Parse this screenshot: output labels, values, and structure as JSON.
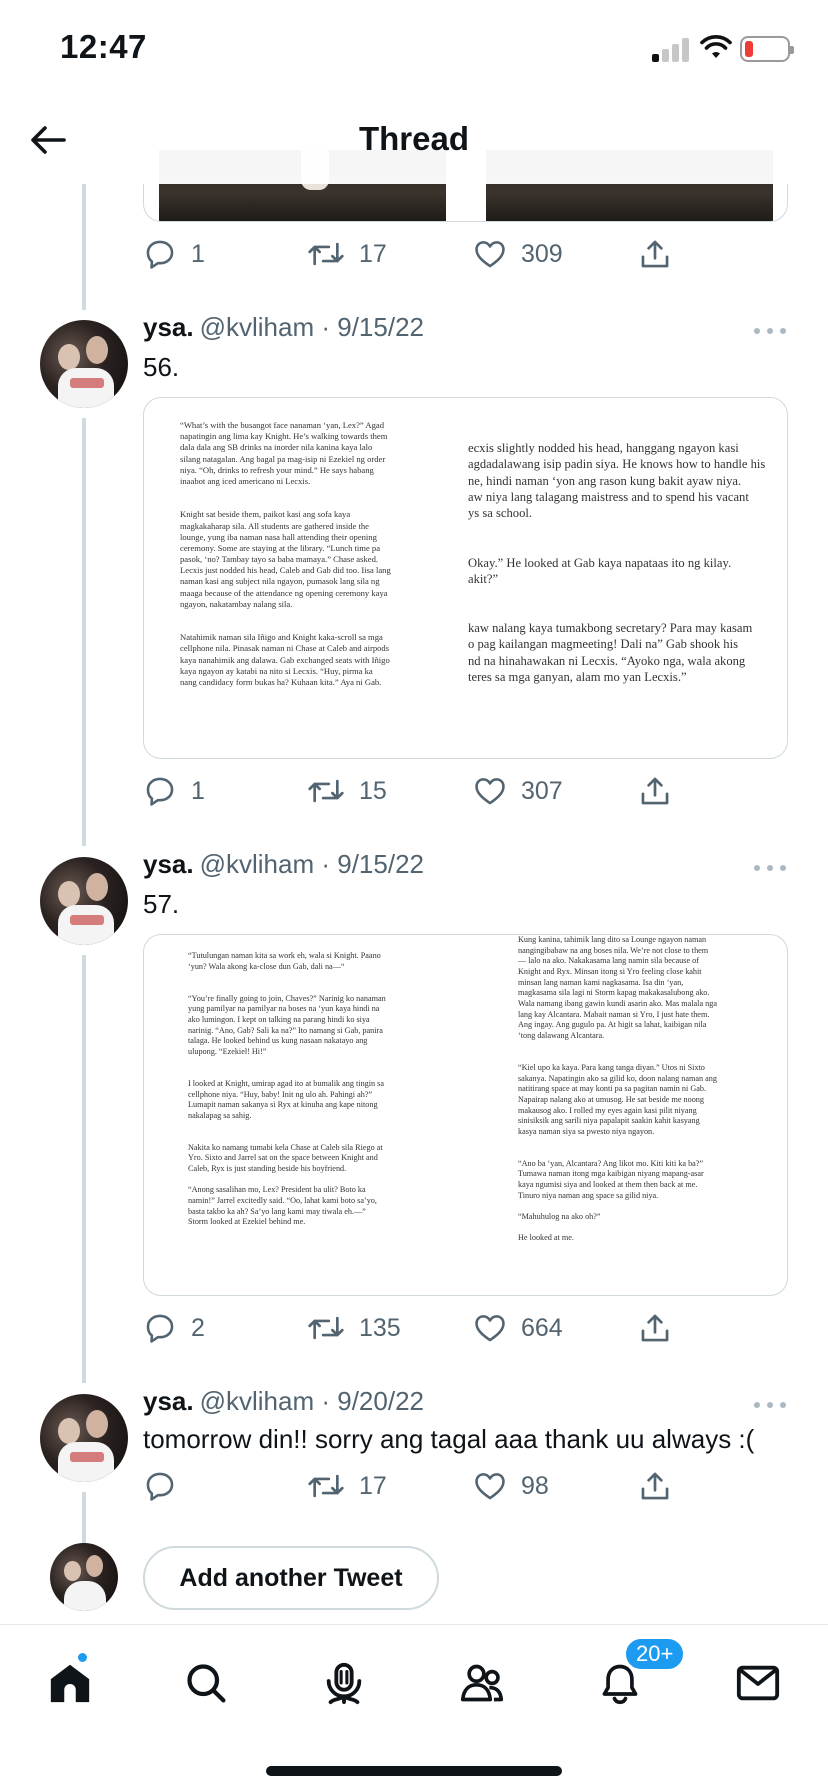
{
  "status_bar": {
    "time": "12:47"
  },
  "header": {
    "title": "Thread"
  },
  "top_tweet_actions": {
    "replies": "1",
    "retweets": "17",
    "likes": "309"
  },
  "tweets": [
    {
      "name": "ysa.",
      "meta": "@kvliham · 9/15/22",
      "text": "56.",
      "actions": {
        "replies": "1",
        "retweets": "15",
        "likes": "307"
      },
      "media_left": [
        "“What’s with the busangot face nanaman ‘yan, Lex?” Agad",
        "napatingin ang lima kay Knight. He’s walking towards them",
        "dala dala ang SB drinks na inorder nila kanina kaya lalo",
        "silang natagalan. Ang bagal pa mag-isip ni Ezekiel ng order",
        "niya. “Oh, drinks to refresh your mind.” He says habang",
        "inaabot ang iced americano ni Lecxis.",
        "",
        "",
        "Knight sat beside them, paikot kasi ang sofa kaya",
        "magkakaharap sila. All students are gathered inside the",
        "lounge, yung iba naman nasa hall attending their opening",
        "ceremony. Some are staying at the library. “Lunch time pa",
        "pasok, ‘no? Tambay tayo sa baba mamaya.” Chase asked.",
        "Lecxis just nodded his head, Caleb and Gab did too. Iisa lang",
        "naman kasi ang subject nila ngayon, pumasok lang sila ng",
        "maaga because of the attendance ng opening ceremony kaya",
        "ngayon, nakatambay nalang sila.",
        "",
        "",
        "Natahimik naman sila Iñigo and Knight kaka-scroll sa mga",
        "cellphone nila. Pinasak naman ni Chase at Caleb and airpods",
        "kaya nanahimik ang dalawa. Gab exchanged seats with Iñigo",
        "kaya ngayon ay katabi na nito si Lecxis. “Huy, pirma ka",
        "nang candidacy form bukas ha? Kuhaan kita.” Aya ni Gab."
      ],
      "media_right": [
        "ecxis slightly nodded his head, hanggang ngayon kasi",
        "agdadalawang isip padin siya. He knows how to handle his",
        "ne, hindi naman ‘yon ang rason kung bakit ayaw niya.",
        "aw niya lang talagang maistress and to spend his vacant",
        "ys sa school.",
        "",
        "",
        "Okay.” He looked at Gab kaya napataas ito ng kilay.",
        "akit?”",
        "",
        "",
        "kaw nalang kaya tumakbong secretary? Para may kasam",
        "o pag kailangan magmeeting! Dali na” Gab shook his",
        "nd na hinahawakan ni Lecxis. “Ayoko nga, wala akong",
        "teres sa mga ganyan, alam mo yan Lecxis.”"
      ]
    },
    {
      "name": "ysa.",
      "meta": "@kvliham · 9/15/22",
      "text": "57.",
      "actions": {
        "replies": "2",
        "retweets": "135",
        "likes": "664"
      },
      "media_left": [
        "“Tutulungan naman kita sa work eh, wala si Knight. Paano",
        "‘yun? Wala akong ka-close dun Gab, dali na—“",
        "",
        "",
        "“You’re finally going to join, Chaves?” Narinig ko nanaman",
        "yung pamilyar na pamilyar na boses na ‘yun kaya hindi na",
        "ako lumingon. I kept on talking na parang hindi ko siya",
        "narinig. “Ano, Gab? Sali ka na?” Ito namang si Gab, panira",
        "talaga. He looked behind us kung nasaan nakatayo ang",
        "ulupong. “Ezekiel! Hi!”",
        "",
        "",
        "I looked at Knight, umirap agad ito at bumalik ang tingin sa",
        "cellphone niya. “Huy, baby! Init ng ulo ah. Pahingi ah?”",
        "Lumapit naman sakanya si Ryx at kinuha ang kape nitong",
        "nakalapag sa sahig.",
        "",
        "",
        "Nakita ko namang tumabi kela Chase at Caleb sila Riego at",
        "Yro. Sixto and Jarrel sat on the space between Knight and",
        "Caleb, Ryx is just standing beside his boyfriend.",
        "",
        "“Anong sasalihan mo, Lex? President ba ulit? Boto ka",
        "namin!” Jarrel excitedly said. “Oo, lahat kami boto sa’yo,",
        "basta takbo ka ah? Sa’yo lang kami may tiwala eh.—”",
        "Storm looked at Ezekiel behind me."
      ],
      "media_right": [
        "Kung kanina, tahimik lang dito sa Lounge ngayon naman",
        "nangingibabaw na ang boses nila. We’re not close to them",
        "— lalo na ako. Nakakasama lang namin sila because of",
        "Knight and Ryx. Minsan itong si Yro feeling close kahit",
        "minsan lang naman kami nagkasama. Isa din ‘yan,",
        "magkasama sila lagi ni Storm kapag makakasalubong ako.",
        "Wala namang ibang gawin kundi asarin ako. Mas malala nga",
        "lang kay Alcantara. Mabait naman si Yro, I just hate them.",
        "Ang ingay. Ang gugulo pa. At higit sa lahat, kaibigan nila",
        "‘tong dalawang Alcantara.",
        "",
        "",
        "“Kiel upo ka kaya. Para kang tanga diyan.” Utos ni Sixto",
        "sakanya. Napatingin ako sa gilid ko, doon nalang naman ang",
        "natitirang space at may konti pa sa pagitan namin ni Gab.",
        "Napairap nalang ako at umusog. He sat beside me noong",
        "makausog ako. I rolled my eyes again kasi pilit niyang",
        "sinisiksik ang sarili niya papalapit saakin kahit kasyang",
        "kasya naman siya sa pwesto niya ngayon.",
        "",
        "",
        "“Ano ba ‘yan, Alcantara? Ang likot mo. Kiti kiti ka ba?”",
        "Tumawa naman itong mga kaibigan niyang mapang-asar",
        "kaya ngumisi siya and looked at them then back at me.",
        "Tinuro niya naman ang space sa gilid niya.",
        "",
        "“Mahuhulog na ako oh?”",
        "",
        "He looked at me."
      ]
    },
    {
      "name": "ysa.",
      "meta": "@kvliham · 9/20/22",
      "text": "tomorrow din!! sorry ang tagal aaa thank uu always :(",
      "actions": {
        "replies": "",
        "retweets": "17",
        "likes": "98"
      }
    }
  ],
  "add_tweet": {
    "label": "Add another Tweet"
  },
  "tabbar": {
    "notifications_badge": "20+"
  },
  "icons": {
    "back": "arrow-left-icon",
    "reply": "speech-bubble-icon",
    "retweet": "retweet-icon",
    "like": "heart-icon",
    "share": "share-icon",
    "more": "ellipsis-icon",
    "home": "home-icon",
    "search": "search-icon",
    "spaces": "microphone-icon",
    "communities": "people-icon",
    "notifications": "bell-icon",
    "messages": "envelope-icon"
  },
  "colors": {
    "accent": "#1d9bf0",
    "muted": "#536471",
    "border": "#cfd9de"
  }
}
